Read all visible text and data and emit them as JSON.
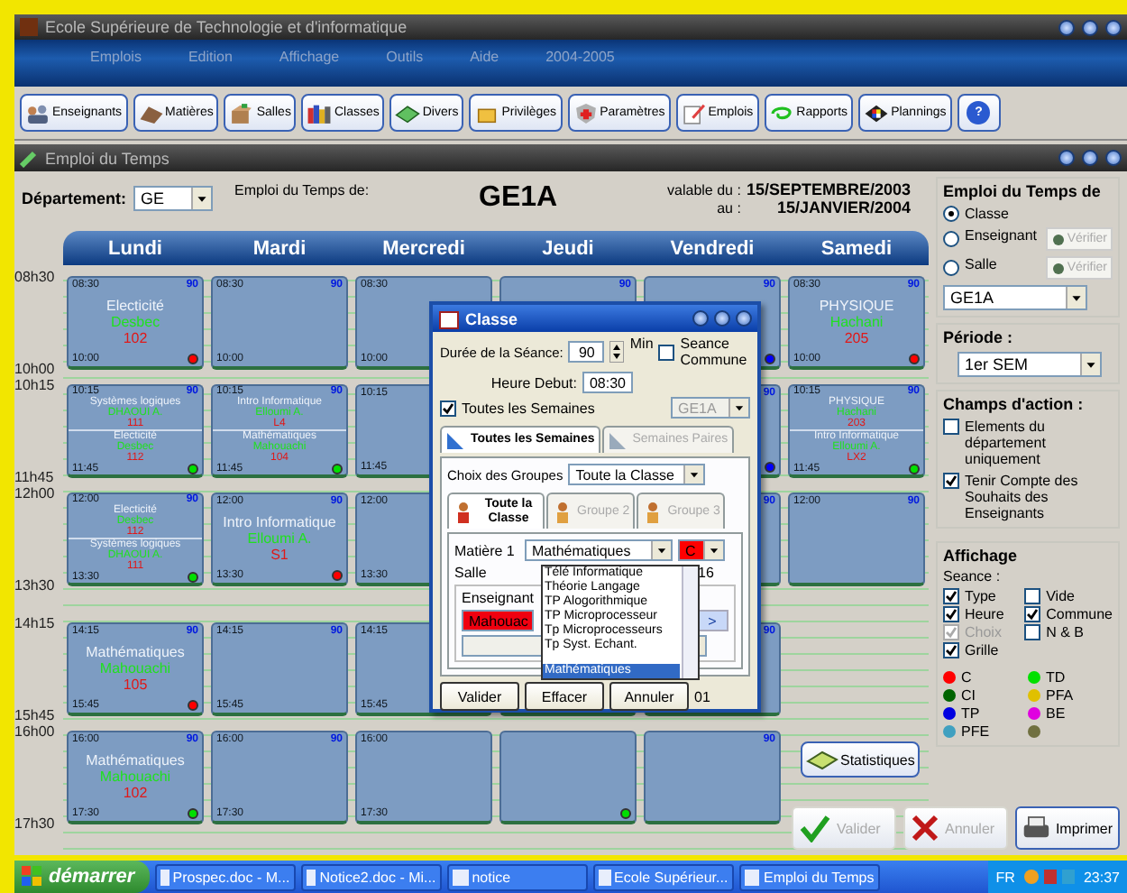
{
  "app_window": {
    "title": "Ecole Supérieure de Technologie et d'informatique"
  },
  "menu": [
    "Emplois",
    "Edition",
    "Affichage",
    "Outils",
    "Aide",
    "2004-2005"
  ],
  "toolbar": [
    {
      "label": "Enseignants",
      "kind": "teachers"
    },
    {
      "label": "Matières",
      "kind": "subjects"
    },
    {
      "label": "Salles",
      "kind": "rooms"
    },
    {
      "label": "Classes",
      "kind": "classes"
    },
    {
      "label": "Divers",
      "kind": "misc"
    },
    {
      "label": "Privilèges",
      "kind": "privileges"
    },
    {
      "label": "Paramètres",
      "kind": "settings"
    },
    {
      "label": "Emplois",
      "kind": "timetables"
    },
    {
      "label": "Rapports",
      "kind": "reports"
    },
    {
      "label": "Plannings",
      "kind": "plannings"
    }
  ],
  "help_button": {
    "label": "?"
  },
  "window": {
    "title": "Emploi du Temps"
  },
  "header": {
    "department_label": "Département:",
    "department": "GE",
    "timetable_label": "Emploi du Temps de:",
    "class_name": "GE1A",
    "valid_from_label": "valable du :",
    "valid_from": "15/SEPTEMBRE/2003",
    "valid_to_label": "au :",
    "valid_to": "15/JANVIER/2004"
  },
  "slots": [
    {
      "start": "08h30",
      "end": "10h00"
    },
    {
      "start": "10h15",
      "end": "11h45"
    },
    {
      "start": "12h00",
      "end": "13h30"
    },
    {
      "start": "14h15",
      "end": "15h45"
    },
    {
      "start": "16h00",
      "end": "17h30"
    }
  ],
  "days": [
    {
      "name": "Lundi",
      "cells": [
        {
          "from": "08:30",
          "to": "10:00",
          "duration": "90",
          "sessions": [
            {
              "subject": "Electicité",
              "teacher": "Desbec",
              "room": "102"
            }
          ],
          "color": "#ff0000"
        },
        {
          "from": "10:15",
          "to": "11:45",
          "duration": "90",
          "sessions": [
            {
              "subject": "Systèmes logiques",
              "teacher": "DHAOUI A.",
              "room": "111"
            },
            {
              "subject": "Electicité",
              "teacher": "Desbec",
              "room": "112"
            }
          ],
          "color": "#00e000"
        },
        {
          "from": "12:00",
          "to": "13:30",
          "duration": "90",
          "sessions": [
            {
              "subject": "Electicité",
              "teacher": "Desbec",
              "room": "112"
            },
            {
              "subject": "Systèmes logiques",
              "teacher": "DHAOUI A.",
              "room": "111"
            }
          ],
          "color": "#00e000"
        },
        {
          "from": "14:15",
          "to": "15:45",
          "duration": "90",
          "sessions": [
            {
              "subject": "Mathématiques",
              "teacher": "Mahouachi",
              "room": "105"
            }
          ],
          "color": "#ff0000"
        },
        {
          "from": "16:00",
          "to": "17:30",
          "duration": "90",
          "sessions": [
            {
              "subject": "Mathématiques",
              "teacher": "Mahouachi",
              "room": "102"
            }
          ],
          "color": "#00e000"
        }
      ]
    },
    {
      "name": "Mardi",
      "cells": [
        {
          "from": "08:30",
          "to": "10:00",
          "duration": "90"
        },
        {
          "from": "10:15",
          "to": "11:45",
          "duration": "90",
          "sessions": [
            {
              "subject": "Intro Informatique",
              "teacher": "Elloumi A.",
              "room": "L4"
            },
            {
              "subject": "Mathématiques",
              "teacher": "Mahouachi",
              "room": "104"
            }
          ],
          "color": "#00e000"
        },
        {
          "from": "12:00",
          "to": "13:30",
          "duration": "90",
          "sessions": [
            {
              "subject": "Intro Informatique",
              "teacher": "Elloumi A.",
              "room": "S1"
            }
          ],
          "color": "#ff0000"
        },
        {
          "from": "14:15",
          "to": "15:45",
          "duration": "90"
        },
        {
          "from": "16:00",
          "to": "17:30",
          "duration": "90"
        }
      ]
    },
    {
      "name": "Mercredi",
      "cells": [
        {
          "from": "08:30",
          "to": "10:00"
        },
        {
          "from": "10:15",
          "to": "11:45"
        },
        {
          "from": "12:00",
          "to": "13:30"
        },
        {
          "from": "14:15",
          "to": "15:45"
        },
        {
          "from": "16:00",
          "to": "17:30"
        }
      ]
    },
    {
      "name": "Jeudi",
      "cells": [
        {
          "duration": "90"
        },
        {},
        {},
        {},
        {
          "color": "#00e000"
        }
      ]
    },
    {
      "name": "Vendredi",
      "cells": [
        {
          "duration": "90",
          "color": "#0000ff"
        },
        {
          "duration": "90",
          "color": "#0000ff"
        },
        {
          "duration": "90"
        },
        {
          "duration": "90"
        },
        {
          "duration": "90"
        }
      ]
    },
    {
      "name": "Samedi",
      "cells": [
        {
          "from": "08:30",
          "to": "10:00",
          "duration": "90",
          "sessions": [
            {
              "subject": "PHYSIQUE",
              "teacher": "Hachani",
              "room": "205"
            }
          ],
          "color": "#ff0000"
        },
        {
          "from": "10:15",
          "to": "11:45",
          "duration": "90",
          "sessions": [
            {
              "subject": "PHYSIQUE",
              "teacher": "Hachani",
              "room": "203"
            },
            {
              "subject": "Intro Informatique",
              "teacher": "Elloumi A.",
              "room": "LX2"
            }
          ],
          "color": "#00e000"
        },
        {
          "from": "12:00",
          "duration": "90"
        },
        null,
        null
      ]
    }
  ],
  "statistics_button": {
    "label": "Statistiques"
  },
  "dialog": {
    "title": "Classe",
    "duration_label": "Durée de la Séance:",
    "duration": "90",
    "duration_unit": "Min",
    "common_session": {
      "label": "Seance Commune",
      "checked": false
    },
    "start_label": "Heure Debut:",
    "start": "08:30",
    "all_weeks": {
      "label": "Toutes les Semaines",
      "checked": true
    },
    "class_select": {
      "value": "GE1A",
      "disabled": true
    },
    "tabs": [
      {
        "label": "Toutes les Semaines",
        "selected": true
      },
      {
        "label": "Semaines Paires",
        "selected": false
      }
    ],
    "groups_label": "Choix des Groupes",
    "groups_value": "Toute la Classe",
    "group_tabs": [
      {
        "label": "Toute la Classe",
        "selected": true
      },
      {
        "label": "Groupe 2",
        "selected": false
      },
      {
        "label": "Groupe 3",
        "selected": false
      }
    ],
    "subject_label": "Matière 1",
    "subject_value": "Mathématiques",
    "type_value": "C",
    "subject_options": [
      {
        "label": "Télé Informatique",
        "selected": false
      },
      {
        "label": "Théorie Langage",
        "selected": false
      },
      {
        "label": "TP Alogorithmique",
        "selected": false
      },
      {
        "label": "TP Microprocesseur",
        "selected": false
      },
      {
        "label": "Tp Microprocesseurs",
        "selected": false
      },
      {
        "label": "Tp Syst. Echant.",
        "selected": false
      },
      {
        "label": "Mathématiques",
        "selected": true
      }
    ],
    "room_label": "Salle",
    "room_value": "16",
    "teacher_label": "Enseignant",
    "teacher_value": "Mahouac",
    "next_label": ">",
    "buttons": [
      "Valider",
      "Effacer",
      "Annuler"
    ],
    "counter": "01"
  },
  "side": {
    "timetable_of": {
      "title": "Emploi du Temps de",
      "options": [
        {
          "label": "Classe",
          "selected": true
        },
        {
          "label": "Enseignant",
          "selected": false,
          "verify_label": "Vérifier"
        },
        {
          "label": "Salle",
          "selected": false,
          "verify_label": "Vérifier"
        }
      ],
      "select": "GE1A"
    },
    "period": {
      "title": "Période :",
      "value": "1er SEM"
    },
    "actions": {
      "title": "Champs d'action :",
      "items": [
        {
          "label": "Elements du département uniquement",
          "checked": false
        },
        {
          "label": "Tenir Compte des Souhaits des Enseignants",
          "checked": true
        }
      ]
    },
    "display": {
      "title": "Affichage",
      "session_label": "Seance :",
      "session_items": [
        {
          "label": "Type",
          "checked": true
        },
        {
          "label": "Vide",
          "checked": false
        },
        {
          "label": "Heure",
          "checked": true
        },
        {
          "label": "Commune",
          "checked": true
        }
      ],
      "choice": {
        "label": "Choix",
        "checked": true,
        "disabled": true
      },
      "grid": {
        "label": "Grille",
        "checked": true
      },
      "bw": {
        "label": "N & B",
        "checked": false
      },
      "legend": [
        {
          "label": "C",
          "color": "#ff0000"
        },
        {
          "label": "TD",
          "color": "#00e000"
        },
        {
          "label": "CI",
          "color": "#006400"
        },
        {
          "label": "PFA",
          "color": "#e0c000"
        },
        {
          "label": "TP",
          "color": "#0000e0"
        },
        {
          "label": "BE",
          "color": "#e000e0"
        },
        {
          "label": "PFE",
          "color": "#40a0c0"
        },
        {
          "color": "#707040"
        }
      ]
    }
  },
  "bottom_buttons": [
    {
      "label": "Valider",
      "kind": "ok",
      "disabled": true
    },
    {
      "label": "Annuler",
      "kind": "cancel",
      "disabled": true
    },
    {
      "label": "Imprimer",
      "kind": "print",
      "disabled": false
    }
  ],
  "taskbar": {
    "start": "démarrer",
    "items": [
      "Prospec.doc - M...",
      "Notice2.doc - Mi...",
      "notice",
      "Ecole Supérieur...",
      "Emploi du Temps"
    ],
    "language": "FR",
    "clock": "23:37"
  }
}
